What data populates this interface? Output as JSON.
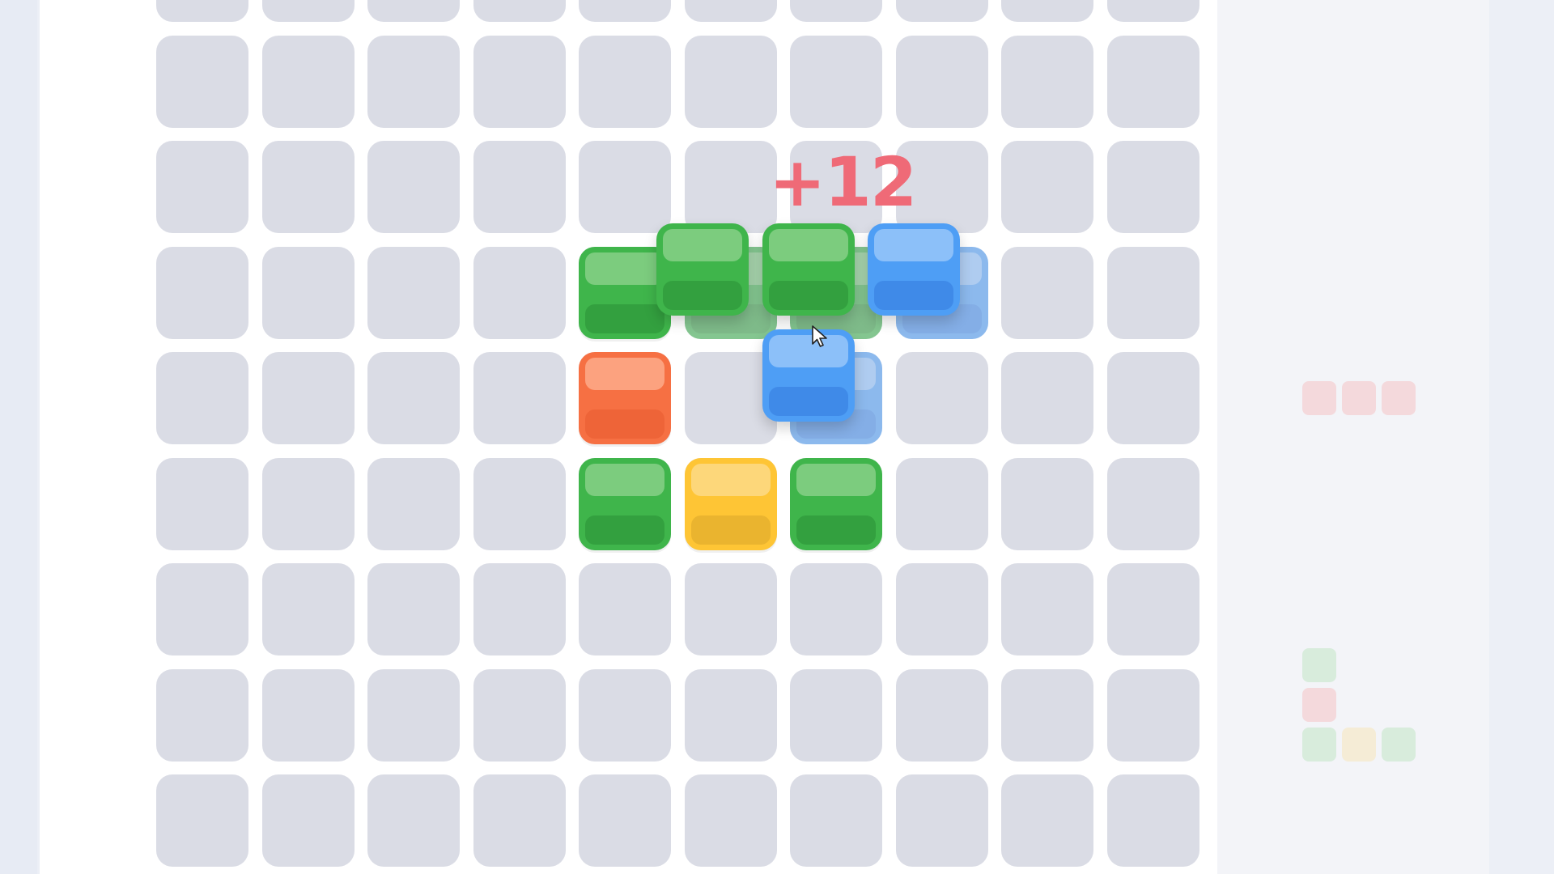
{
  "colors": {
    "page_bg": "#eceff6",
    "board_bg": "#ffffff",
    "empty_cell": "#dadce5",
    "side_panel": "#f3f4f8",
    "score_pop": "#ef6a77"
  },
  "palette": {
    "green": {
      "base": "#3fb54b",
      "top": "#7ccc7e",
      "bot": "#33a03f"
    },
    "blue": {
      "base": "#4e9ef5",
      "top": "#8cc0f9",
      "bot": "#3f8ae8"
    },
    "orange": {
      "base": "#f67043",
      "top": "#fca27f",
      "bot": "#ee6438"
    },
    "yellow": {
      "base": "#fec535",
      "top": "#fdd77a",
      "bot": "#eab42f"
    }
  },
  "board": {
    "columns": 10,
    "visible_rows": 9,
    "placed_blocks": [
      {
        "row": 3,
        "col": 4,
        "color": "green"
      },
      {
        "row": 4,
        "col": 4,
        "color": "orange"
      },
      {
        "row": 5,
        "col": 4,
        "color": "green"
      },
      {
        "row": 5,
        "col": 5,
        "color": "yellow"
      },
      {
        "row": 5,
        "col": 6,
        "color": "green"
      }
    ],
    "ghost_blocks": [
      {
        "row": 3,
        "col": 5,
        "color": "green"
      },
      {
        "row": 3,
        "col": 6,
        "color": "green"
      },
      {
        "row": 3,
        "col": 7,
        "color": "blue"
      },
      {
        "row": 4,
        "col": 6,
        "color": "blue"
      }
    ],
    "dragged_piece": [
      {
        "dr": 0,
        "dc": 0,
        "color": "green"
      },
      {
        "dr": 0,
        "dc": 1,
        "color": "green"
      },
      {
        "dr": 0,
        "dc": 2,
        "color": "blue"
      },
      {
        "dr": 1,
        "dc": 1,
        "color": "blue"
      }
    ]
  },
  "score_popup": "+12",
  "next_pieces": [
    {
      "name": "piece-1",
      "cells": [
        {
          "r": 0,
          "c": 0,
          "color": "#f4d9dc"
        },
        {
          "r": 0,
          "c": 1,
          "color": "#f4d9dc"
        },
        {
          "r": 0,
          "c": 2,
          "color": "#f4d9dc"
        }
      ]
    },
    {
      "name": "piece-2",
      "cells": [
        {
          "r": 0,
          "c": 0,
          "color": "#d8ecdc"
        },
        {
          "r": 1,
          "c": 0,
          "color": "#f4d9dc"
        },
        {
          "r": 2,
          "c": 0,
          "color": "#d8ecdc"
        },
        {
          "r": 2,
          "c": 1,
          "color": "#f5ecd6"
        },
        {
          "r": 2,
          "c": 2,
          "color": "#d8ecdc"
        }
      ]
    }
  ],
  "icons": {
    "cursor": "mouse-pointer-icon"
  }
}
